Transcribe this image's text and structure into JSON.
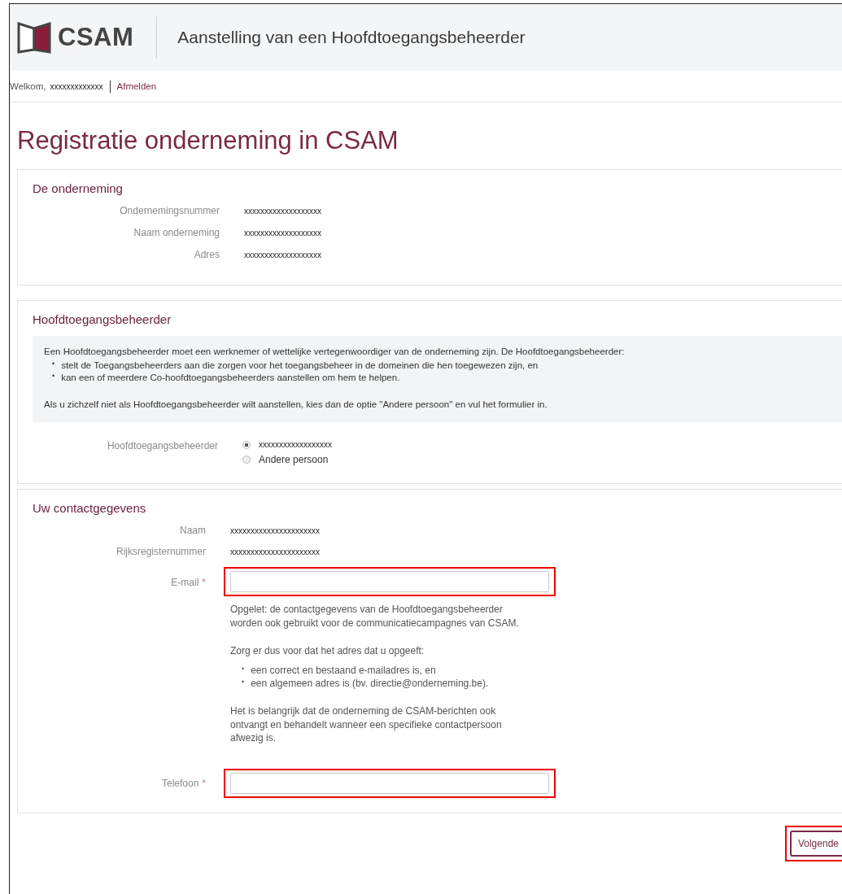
{
  "header": {
    "logo_text": "CSAM",
    "title": "Aanstelling van een Hoofdtoegangsbeheerder"
  },
  "user_bar": {
    "greeting": "Welkom,",
    "user": "xxxxxxxxxxxxx",
    "logout": "Afmelden"
  },
  "page_title": "Registratie onderneming in CSAM",
  "sections": [
    {
      "kind": "fields",
      "title": "De onderneming",
      "fields": [
        {
          "label": "Ondernemingsnummer",
          "value": "xxxxxxxxxxxxxxxxxxx"
        },
        {
          "label": "Naam onderneming",
          "value": "xxxxxxxxxxxxxxxxxxx"
        },
        {
          "label": "Adres",
          "value": "xxxxxxxxxxxxxxxxxxx"
        }
      ]
    },
    {
      "kind": "choice",
      "title": "Hoofdtoegangsbeheerder",
      "info": {
        "bullet_mark": "•",
        "intro": "Een Hoofdtoegangsbeheerder moet een werknemer of wettelijke vertegenwoordiger van de onderneming zijn. De Hoofdtoegangsbeheerder:",
        "bullets": [
          "stelt de Toegangsbeheerders aan die zorgen voor het toegangsbeheer in de domeinen die hen toegewezen zijn, en",
          "kan een of meerdere Co-hoofdtoegangsbeheerders aanstellen om hem te helpen."
        ],
        "note": "Als u zichzelf niet als Hoofdtoegangsbeheerder wilt aanstellen, kies dan de optie \"Andere persoon\" en vul het formulier in."
      },
      "choice": {
        "label": "Hoofdtoegangsbeheerder",
        "options": [
          {
            "label": "xxxxxxxxxxxxxxxxxx",
            "selected": true
          },
          {
            "label": "Andere persoon",
            "selected": false
          }
        ]
      }
    },
    {
      "kind": "contact",
      "title": "Uw contactgegevens",
      "fields": [
        {
          "kind": "text",
          "label": "Naam",
          "value": "xxxxxxxxxxxxxxxxxxxxxx"
        },
        {
          "kind": "text",
          "label": "Rijksregisternummer",
          "value": "xxxxxxxxxxxxxxxxxxxxxx"
        },
        {
          "kind": "input",
          "label": "E-mail",
          "required_mark": "*",
          "highlighted": true,
          "help": [
            {
              "kind": "p",
              "text": "Opgelet: de contactgegevens van de Hoofdtoegangsbeheerder worden ook gebruikt voor de communicatiecampagnes van CSAM."
            },
            {
              "kind": "p",
              "text": "Zorg er dus voor dat het adres dat u opgeeft:"
            },
            {
              "kind": "list",
              "mark": "•",
              "items": [
                "een correct en bestaand e-mailadres is, en",
                "een algemeen adres is (bv. directie@onderneming.be)."
              ]
            },
            {
              "kind": "p",
              "text": "Het is belangrijk dat de onderneming de CSAM-berichten ook ontvangt en behandelt wanneer een specifieke contactpersoon afwezig is."
            }
          ]
        },
        {
          "kind": "input",
          "label": "Telefoon",
          "required_mark": "*",
          "highlighted": true
        }
      ]
    }
  ],
  "buttons": [
    {
      "label": "Volgende",
      "highlighted": true
    }
  ]
}
